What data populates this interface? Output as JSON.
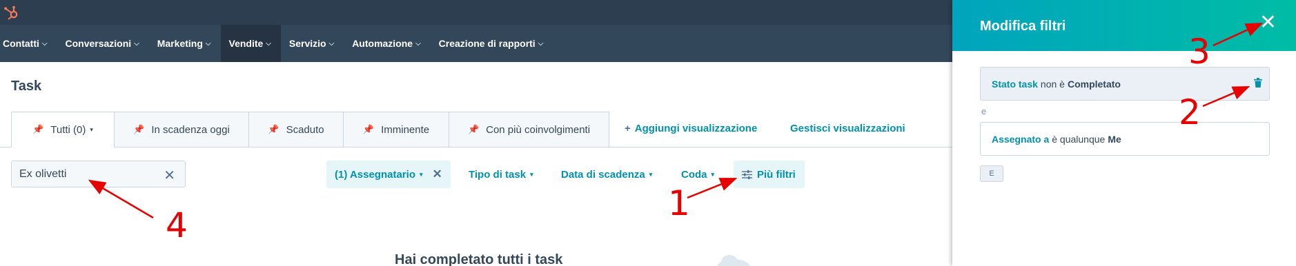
{
  "nav": {
    "items": [
      {
        "label": "Contatti",
        "chevron": "⌵"
      },
      {
        "label": "Conversazioni",
        "chevron": "⌵"
      },
      {
        "label": "Marketing",
        "chevron": "⌵"
      },
      {
        "label": "Vendite",
        "chevron": "⌵"
      },
      {
        "label": "Servizio",
        "chevron": "⌵"
      },
      {
        "label": "Automazione",
        "chevron": "⌵"
      },
      {
        "label": "Creazione di rapporti",
        "chevron": "⌵"
      }
    ],
    "active_index": 3
  },
  "page": {
    "title": "Task",
    "empty_title": "Hai completato tutti i task"
  },
  "tabs": [
    {
      "label": "Tutti (0)",
      "caret": "▾"
    },
    {
      "label": "In scadenza oggi"
    },
    {
      "label": "Scaduto"
    },
    {
      "label": "Imminente"
    },
    {
      "label": "Con più coinvolgimenti"
    }
  ],
  "tab_links": {
    "add_plus": "+",
    "add_view": "Aggiungi visualizzazione",
    "manage_views": "Gestisci visualizzazioni"
  },
  "search": {
    "value": "Ex olivetti",
    "clear": "✕"
  },
  "filters": {
    "assignee": "(1) Assegnatario",
    "assignee_remove": "✕",
    "task_type": "Tipo di task",
    "due_date": "Data di scadenza",
    "queue": "Coda",
    "more_filters": "Più filtri",
    "caret": "▾"
  },
  "panel": {
    "title": "Modifica filtri",
    "close": "✕",
    "rule1": {
      "property": "Stato task",
      "operator": "non è",
      "value": "Completato"
    },
    "and_label": "e",
    "rule2": {
      "property": "Assegnato a",
      "operator": "è qualunque",
      "value": "Me"
    },
    "and_button": "E"
  },
  "annotations": [
    "1",
    "2",
    "3",
    "4"
  ],
  "colors": {
    "nav_bg": "#33475b",
    "topbar_bg": "#2d3e50",
    "link": "#0091ae",
    "panel_gradient_start": "#00a4bd",
    "panel_gradient_end": "#00bda5",
    "annotation_red": "#e60000",
    "logo_orange": "#ff7a59"
  }
}
